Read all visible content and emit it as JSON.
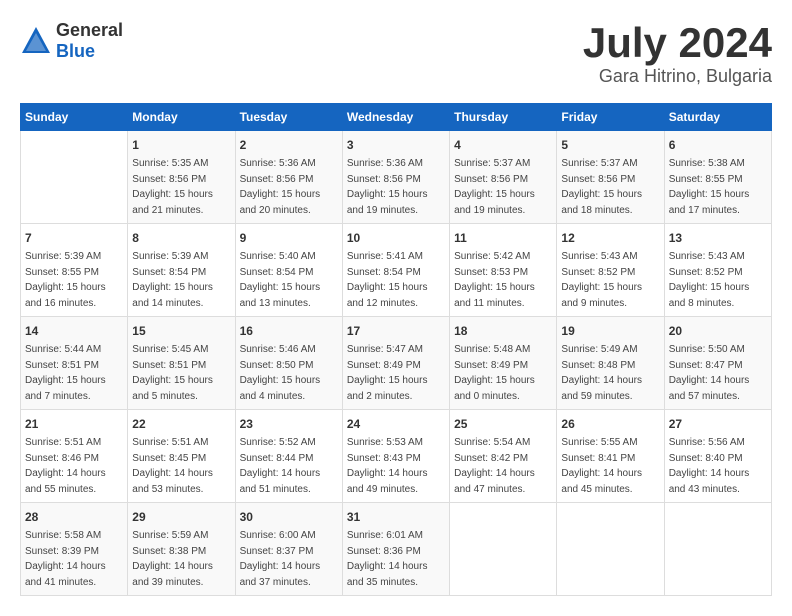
{
  "logo": {
    "general": "General",
    "blue": "Blue"
  },
  "title": "July 2024",
  "subtitle": "Gara Hitrino, Bulgaria",
  "days_of_week": [
    "Sunday",
    "Monday",
    "Tuesday",
    "Wednesday",
    "Thursday",
    "Friday",
    "Saturday"
  ],
  "weeks": [
    [
      {
        "day": "",
        "info": ""
      },
      {
        "day": "1",
        "info": "Sunrise: 5:35 AM\nSunset: 8:56 PM\nDaylight: 15 hours\nand 21 minutes."
      },
      {
        "day": "2",
        "info": "Sunrise: 5:36 AM\nSunset: 8:56 PM\nDaylight: 15 hours\nand 20 minutes."
      },
      {
        "day": "3",
        "info": "Sunrise: 5:36 AM\nSunset: 8:56 PM\nDaylight: 15 hours\nand 19 minutes."
      },
      {
        "day": "4",
        "info": "Sunrise: 5:37 AM\nSunset: 8:56 PM\nDaylight: 15 hours\nand 19 minutes."
      },
      {
        "day": "5",
        "info": "Sunrise: 5:37 AM\nSunset: 8:56 PM\nDaylight: 15 hours\nand 18 minutes."
      },
      {
        "day": "6",
        "info": "Sunrise: 5:38 AM\nSunset: 8:55 PM\nDaylight: 15 hours\nand 17 minutes."
      }
    ],
    [
      {
        "day": "7",
        "info": "Sunrise: 5:39 AM\nSunset: 8:55 PM\nDaylight: 15 hours\nand 16 minutes."
      },
      {
        "day": "8",
        "info": "Sunrise: 5:39 AM\nSunset: 8:54 PM\nDaylight: 15 hours\nand 14 minutes."
      },
      {
        "day": "9",
        "info": "Sunrise: 5:40 AM\nSunset: 8:54 PM\nDaylight: 15 hours\nand 13 minutes."
      },
      {
        "day": "10",
        "info": "Sunrise: 5:41 AM\nSunset: 8:54 PM\nDaylight: 15 hours\nand 12 minutes."
      },
      {
        "day": "11",
        "info": "Sunrise: 5:42 AM\nSunset: 8:53 PM\nDaylight: 15 hours\nand 11 minutes."
      },
      {
        "day": "12",
        "info": "Sunrise: 5:43 AM\nSunset: 8:52 PM\nDaylight: 15 hours\nand 9 minutes."
      },
      {
        "day": "13",
        "info": "Sunrise: 5:43 AM\nSunset: 8:52 PM\nDaylight: 15 hours\nand 8 minutes."
      }
    ],
    [
      {
        "day": "14",
        "info": "Sunrise: 5:44 AM\nSunset: 8:51 PM\nDaylight: 15 hours\nand 7 minutes."
      },
      {
        "day": "15",
        "info": "Sunrise: 5:45 AM\nSunset: 8:51 PM\nDaylight: 15 hours\nand 5 minutes."
      },
      {
        "day": "16",
        "info": "Sunrise: 5:46 AM\nSunset: 8:50 PM\nDaylight: 15 hours\nand 4 minutes."
      },
      {
        "day": "17",
        "info": "Sunrise: 5:47 AM\nSunset: 8:49 PM\nDaylight: 15 hours\nand 2 minutes."
      },
      {
        "day": "18",
        "info": "Sunrise: 5:48 AM\nSunset: 8:49 PM\nDaylight: 15 hours\nand 0 minutes."
      },
      {
        "day": "19",
        "info": "Sunrise: 5:49 AM\nSunset: 8:48 PM\nDaylight: 14 hours\nand 59 minutes."
      },
      {
        "day": "20",
        "info": "Sunrise: 5:50 AM\nSunset: 8:47 PM\nDaylight: 14 hours\nand 57 minutes."
      }
    ],
    [
      {
        "day": "21",
        "info": "Sunrise: 5:51 AM\nSunset: 8:46 PM\nDaylight: 14 hours\nand 55 minutes."
      },
      {
        "day": "22",
        "info": "Sunrise: 5:51 AM\nSunset: 8:45 PM\nDaylight: 14 hours\nand 53 minutes."
      },
      {
        "day": "23",
        "info": "Sunrise: 5:52 AM\nSunset: 8:44 PM\nDaylight: 14 hours\nand 51 minutes."
      },
      {
        "day": "24",
        "info": "Sunrise: 5:53 AM\nSunset: 8:43 PM\nDaylight: 14 hours\nand 49 minutes."
      },
      {
        "day": "25",
        "info": "Sunrise: 5:54 AM\nSunset: 8:42 PM\nDaylight: 14 hours\nand 47 minutes."
      },
      {
        "day": "26",
        "info": "Sunrise: 5:55 AM\nSunset: 8:41 PM\nDaylight: 14 hours\nand 45 minutes."
      },
      {
        "day": "27",
        "info": "Sunrise: 5:56 AM\nSunset: 8:40 PM\nDaylight: 14 hours\nand 43 minutes."
      }
    ],
    [
      {
        "day": "28",
        "info": "Sunrise: 5:58 AM\nSunset: 8:39 PM\nDaylight: 14 hours\nand 41 minutes."
      },
      {
        "day": "29",
        "info": "Sunrise: 5:59 AM\nSunset: 8:38 PM\nDaylight: 14 hours\nand 39 minutes."
      },
      {
        "day": "30",
        "info": "Sunrise: 6:00 AM\nSunset: 8:37 PM\nDaylight: 14 hours\nand 37 minutes."
      },
      {
        "day": "31",
        "info": "Sunrise: 6:01 AM\nSunset: 8:36 PM\nDaylight: 14 hours\nand 35 minutes."
      },
      {
        "day": "",
        "info": ""
      },
      {
        "day": "",
        "info": ""
      },
      {
        "day": "",
        "info": ""
      }
    ]
  ]
}
